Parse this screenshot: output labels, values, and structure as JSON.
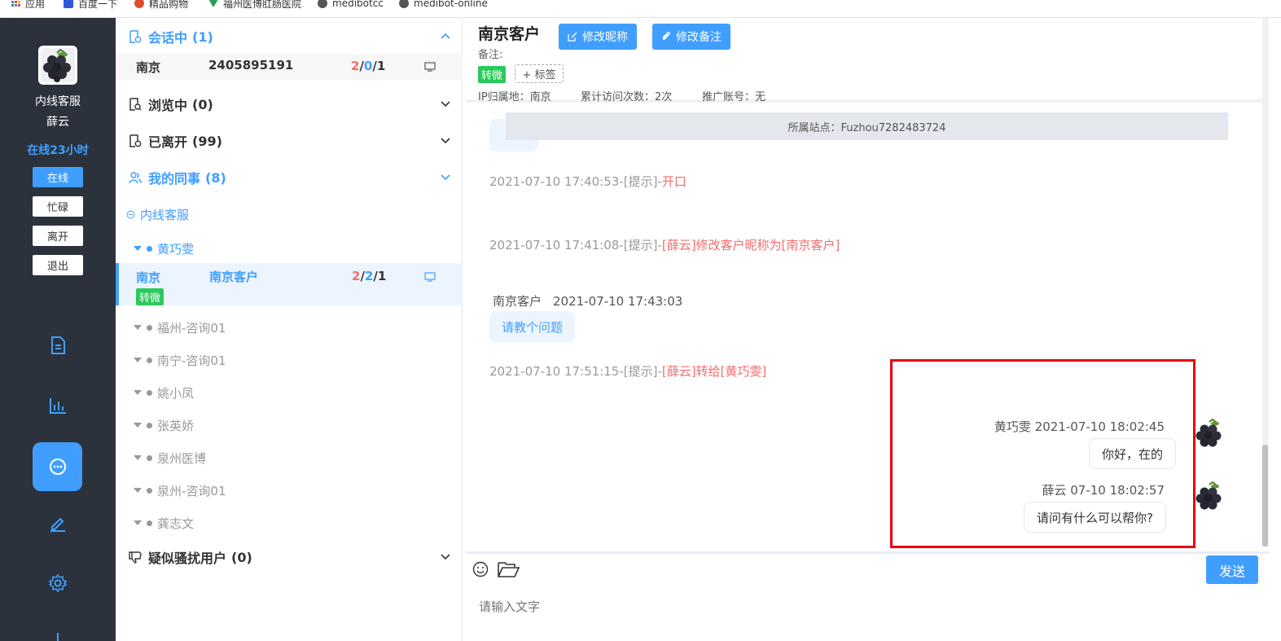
{
  "bookmarks": [
    {
      "label": "应用",
      "color": "#4a7de2"
    },
    {
      "label": "百度一下",
      "color": "#2d56d6"
    },
    {
      "label": "精品购物",
      "color": "#e24c2d"
    },
    {
      "label": "福州医博肛肠医院",
      "color": "#2a9d5c"
    },
    {
      "label": "medibotcc",
      "color": "#555555"
    },
    {
      "label": "medibot-online",
      "color": "#555555"
    }
  ],
  "agent": {
    "role": "内线客服",
    "name": "薛云",
    "online_time": "在线23小时",
    "status_buttons": [
      "在线",
      "忙碌",
      "离开",
      "退出"
    ],
    "active_status": "在线"
  },
  "sections": {
    "in_session": {
      "label": "会话中",
      "count": "(1)"
    },
    "browsing": {
      "label": "浏览中",
      "count": "(0)"
    },
    "left": {
      "label": "已离开",
      "count": "(99)"
    },
    "colleagues": {
      "label": "我的同事",
      "count": "(8)"
    },
    "harass": {
      "label": "疑似骚扰用户",
      "count": "(0)"
    }
  },
  "session_row": {
    "location": "南京",
    "id": "2405895191",
    "counts": {
      "a": "2",
      "b": "0",
      "c": "1",
      "sep": "/"
    }
  },
  "colleague_group": "内线客服",
  "colleague_active": "黄巧雯",
  "active_visitor": {
    "location": "南京",
    "name": "南京客户",
    "counts": {
      "a": "2",
      "b": "2",
      "c": "1",
      "sep": "/"
    },
    "tag": "转微"
  },
  "colleagues_other": [
    "福州-咨询01",
    "南宁-咨询01",
    "姚小凤",
    "张英娇",
    "泉州医博",
    "泉州-咨询01",
    "龚志文"
  ],
  "chat_header": {
    "title": "南京客户",
    "edit_nick": "修改昵称",
    "edit_note": "修改备注",
    "note_label": "备注:",
    "tag": "转微",
    "add_tag": "+ 标签",
    "ip_label": "IP归属地：南京",
    "visits_label": "累计访问次数：2次",
    "promo_label": "推广账号：无",
    "site_label": "所属站点：Fuzhou7282483724"
  },
  "messages": {
    "sys1": {
      "text": "2021-07-10 17:40:53-[提示]-",
      "highlight": "开口"
    },
    "sys2": {
      "text": "2021-07-10 17:41:08-[提示]-",
      "highlight": "[薛云]修改客户昵称为[南京客户]"
    },
    "visitor_header": {
      "name": "南京客户",
      "time": "2021-07-10 17:43:03"
    },
    "visitor_msg": "请教个问题",
    "sys3": {
      "text": "2021-07-10 17:51:15-[提示]-",
      "highlight": "[薛云]转给[黄巧雯]"
    },
    "agent1": {
      "header": "黄巧雯 2021-07-10 18:02:45",
      "text": "你好，在的"
    },
    "agent2": {
      "header": "薛云 07-10 18:02:57",
      "text": "请问有什么可以帮你?"
    }
  },
  "input": {
    "send": "发送",
    "placeholder": "请输入文字"
  },
  "colors": {
    "accent": "#409eff",
    "red": "#f56c6c",
    "green": "#2bc95b",
    "nav_bg": "#2b323c",
    "highlight_box": "#e60012"
  }
}
